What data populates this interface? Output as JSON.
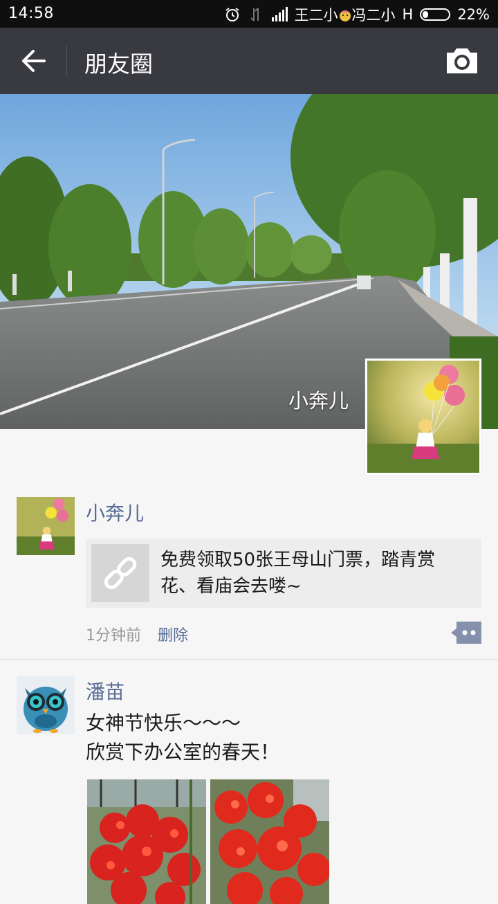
{
  "status_bar": {
    "time": "14:58",
    "carrier": "王二小",
    "carrier2": "冯二小",
    "network": "H",
    "battery": "22%",
    "battery_level": 0.22
  },
  "header": {
    "title": "朋友圈"
  },
  "cover": {
    "user_name": "小奔儿"
  },
  "posts": [
    {
      "user": "小奔儿",
      "link_title": "免费领取50张王母山门票，踏青赏花、看庙会去喽~",
      "time": "1分钟前",
      "delete_label": "删除"
    },
    {
      "user": "潘苗",
      "text_line1": "女神节快乐～～～",
      "text_line2": "欣赏下办公室的春天！"
    }
  ],
  "colors": {
    "header_bg": "#393a3f",
    "name_link": "#576b95",
    "page_bg": "#f6f6f6"
  }
}
